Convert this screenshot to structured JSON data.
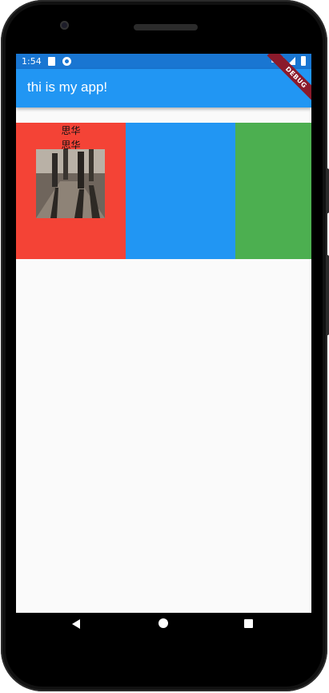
{
  "statusbar": {
    "time": "1:54",
    "network": "LTE"
  },
  "appbar": {
    "title": "thi is my app!",
    "debug_banner": "DEBUG"
  },
  "content": {
    "cell_red": {
      "text_lines": [
        "思华",
        "思华"
      ]
    },
    "colors": {
      "red": "#f44336",
      "blue": "#2196f3",
      "green": "#4caf50",
      "appbar": "#2196f3"
    }
  },
  "navbar": {
    "icons": [
      "back-icon",
      "home-icon",
      "recents-icon"
    ]
  }
}
